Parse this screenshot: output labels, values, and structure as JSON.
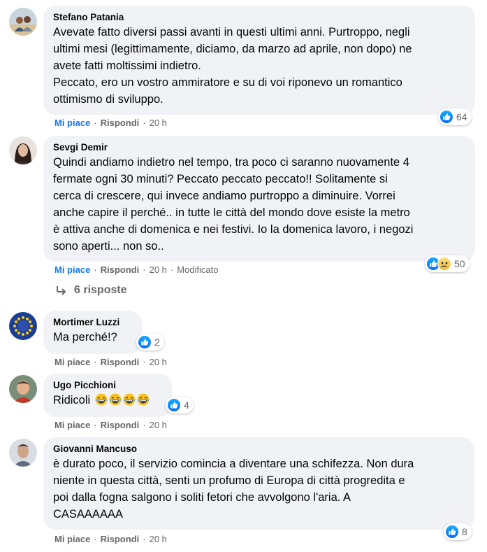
{
  "comments": [
    {
      "author": "Stefano Patania",
      "text": "Avevate fatto diversi passi avanti in questi ultimi anni. Purtroppo, negli\nultimi mesi (legittimamente, diciamo, da marzo ad aprile, non dopo) ne\navete fatti moltissimi indietro.\nPeccato, ero un vostro ammiratore e su di voi riponevo un romantico\nottimismo di sviluppo.",
      "like_label": "Mi piace",
      "reply_label": "Rispondi",
      "time": "20 h",
      "reaction_count": "64"
    },
    {
      "author": "Sevgi Demir",
      "text": "Quindi andiamo indietro nel tempo, tra poco ci saranno nuovamente 4\nfermate ogni 30 minuti? Peccato peccato peccato!! Solitamente si\ncerca di crescere, qui invece andiamo purtroppo a diminuire. Vorrei\nanche capire il perché.. in tutte le città del mondo dove esiste la metro\nè attiva anche di domenica e nei festivi. Io la domenica lavoro, i negozi\nsono aperti... non so..",
      "like_label": "Mi piace",
      "reply_label": "Rispondi",
      "time": "20 h",
      "edited": "Modificato",
      "reaction_count": "50",
      "replies_label": "6 risposte"
    },
    {
      "author": "Mortimer Luzzi",
      "text": "Ma perché!?",
      "like_label": "Mi piace",
      "reply_label": "Rispondi",
      "time": "20 h",
      "reaction_count": "2"
    },
    {
      "author": "Ugo Picchioni",
      "text": "Ridicoli",
      "like_label": "Mi piace",
      "reply_label": "Rispondi",
      "time": "20 h",
      "reaction_count": "4"
    },
    {
      "author": "Giovanni Mancuso",
      "text": "è durato poco, il servizio comincia a diventare una schifezza. Non dura\nniente in questa città, senti un profumo di Europa di città progredita e\npoi dalla fogna salgono i soliti fetori che avvolgono l'aria. A\nCASAAAAAA",
      "like_label": "Mi piace",
      "reply_label": "Rispondi",
      "time": "20 h",
      "reaction_count": "8"
    }
  ],
  "colors": {
    "bubble": "#f0f2f5",
    "like_blue": "#1877f2",
    "meta_gray": "#65676b"
  },
  "icons": {
    "like": "thumbs-up-icon",
    "sad": "sad-face-icon",
    "laugh": "laughing-emoji-icon",
    "reply_arrow": "reply-arrow-icon"
  }
}
